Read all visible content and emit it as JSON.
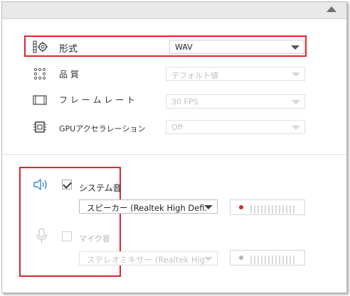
{
  "format": {
    "label": "形式",
    "value": "WAV",
    "icon": "video-settings-icon"
  },
  "quality": {
    "label": "品 質",
    "value": "デフォルト値",
    "icon": "dots-grid-icon"
  },
  "framerate": {
    "label": "フ レ ー ム レ ー ト",
    "value": "30 FPS",
    "icon": "film-strip-icon"
  },
  "gpu": {
    "label": "GPUアクセラレーション",
    "value": "Off",
    "icon": "chip-icon"
  },
  "system_audio": {
    "label": "システム音",
    "checked": true,
    "device": "スピーカー (Realtek High Defi...",
    "icon": "speaker-icon",
    "meter_dot_color": "#e0252c"
  },
  "mic_audio": {
    "label": "マイク音",
    "checked": false,
    "device": "ステレオミキサー (Realtek Hig...",
    "icon": "microphone-icon",
    "meter_dot_color": "#b5b5b5"
  },
  "colors": {
    "highlight": "#e0252c",
    "accent_blue": "#2d8fd5"
  }
}
